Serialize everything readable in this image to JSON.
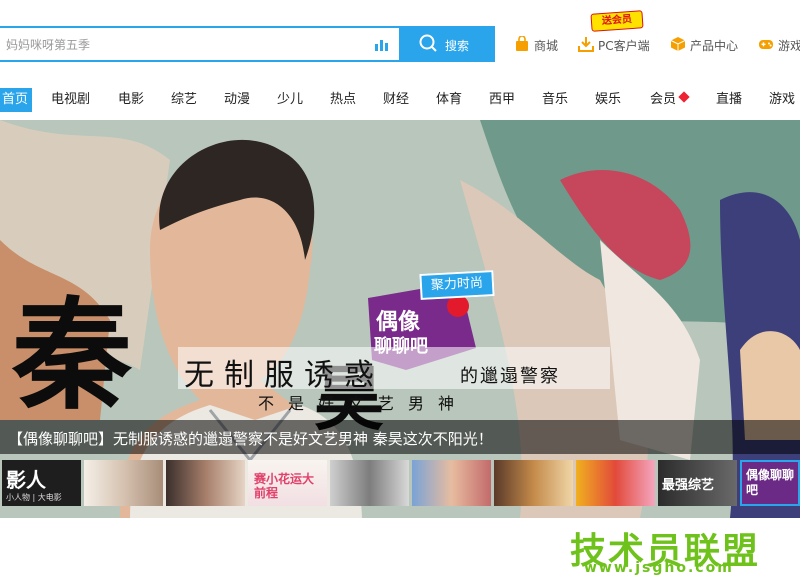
{
  "search": {
    "placeholder": "妈妈咪呀第五季",
    "button_label": "搜索"
  },
  "top_links": [
    {
      "label": "商城",
      "icon": "shopping-bag-icon",
      "color": "#f5a000"
    },
    {
      "label": "PC客户端",
      "icon": "download-icon",
      "color": "#f5a000"
    },
    {
      "label": "产品中心",
      "icon": "box-icon",
      "color": "#f5a000"
    },
    {
      "label": "游戏",
      "icon": "gamepad-icon",
      "color": "#f5a000"
    }
  ],
  "vip_tag": "送会员",
  "nav": {
    "items": [
      "首页",
      "电视剧",
      "电影",
      "综艺",
      "动漫",
      "少儿",
      "热点",
      "财经",
      "体育",
      "西甲",
      "音乐",
      "娱乐",
      "会员",
      "直播",
      "游戏"
    ],
    "active_index": 0
  },
  "banner": {
    "big_char_1": "秦",
    "big_char_2": "昊",
    "badge_top": "聚力时尚",
    "badge_line1": "偶像",
    "badge_line2": "聊聊吧",
    "slogan_main": "无制服诱惑",
    "slogan_sub1": "的邋遢警察",
    "slogan_sub2": "不是好文艺男神",
    "caption": "【偶像聊聊吧】无制服诱惑的邋遢警察不是好文艺男神 秦昊这次不阳光！"
  },
  "thumbnails": [
    {
      "label": "影人",
      "sub": "小人物 | 大电影"
    },
    {
      "label": ""
    },
    {
      "label": ""
    },
    {
      "label": "赛小花运大前程"
    },
    {
      "label": ""
    },
    {
      "label": ""
    },
    {
      "label": ""
    },
    {
      "label": ""
    },
    {
      "label": "最强综艺"
    },
    {
      "label": "偶像聊聊吧"
    }
  ],
  "watermark": {
    "main": "技术员联盟",
    "url": "www.jsgho.com"
  },
  "colors": {
    "accent": "#2aa4ea",
    "watermark": "#6fc21b",
    "nav_text": "#222222"
  }
}
